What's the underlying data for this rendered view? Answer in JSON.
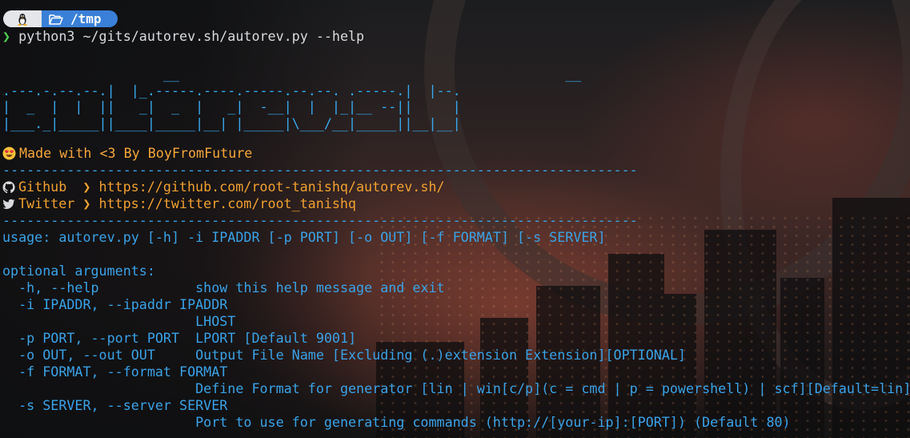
{
  "prompt": {
    "os_icon": "linux-tux-icon",
    "folder_icon": "folder-open-icon",
    "directory": "/tmp",
    "arrow": "❯",
    "command": "python3 ~/gits/autorev.sh/autorev.py --help"
  },
  "banner": {
    "ascii_art": [
      "                    __                                                __",
      ".---.-.--.--.|  |_.-----.----.-----.--.--. .-----.|  |--.",
      "|  _  |  |  ||   _|  _  |   _|  -__|  |  |_|__ --||     |",
      "|___._|_____||____|_____|__| |_____|\\___/__|_____||__|__|"
    ],
    "made_with": "Made with <3 By BoyFromFuture",
    "separator": "-------------------------------------------------------------------------------",
    "github_label": "Github  ❯",
    "github_url": "https://github.com/root-tanishq/autorev.sh/",
    "twitter_label": "Twitter ❯",
    "twitter_url": "https://twitter.com/root_tanishq"
  },
  "help": {
    "usage": "usage: autorev.py [-h] -i IPADDR [-p PORT] [-o OUT] [-f FORMAT] [-s SERVER]",
    "section": "optional arguments:",
    "options": [
      "  -h, --help            show this help message and exit",
      "  -i IPADDR, --ipaddr IPADDR",
      "                        LHOST",
      "  -p PORT, --port PORT  LPORT [Default 9001]",
      "  -o OUT, --out OUT     Output File Name [Excluding (.)extension Extension][OPTIONAL]",
      "  -f FORMAT, --format FORMAT",
      "                        Define Format for generator [lin | win[c/p](c = cmd | p = powershell) | scf][Default=lin]",
      "  -s SERVER, --server SERVER",
      "                        Port to use for generating commands (http://[your-ip]:[PORT]) (Default 80)"
    ]
  },
  "colors": {
    "accent_blue": "#3aa2e6",
    "accent_orange": "#f0a030",
    "prompt_green": "#50d050",
    "pill_blue": "#3a80d8"
  }
}
